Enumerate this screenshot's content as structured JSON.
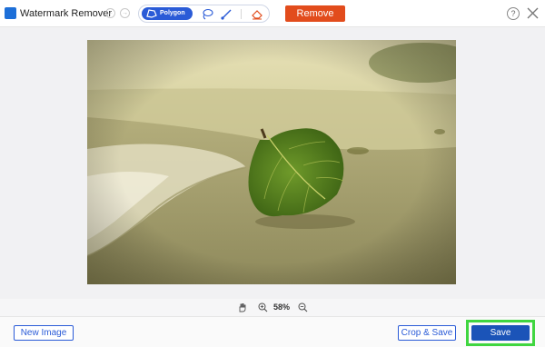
{
  "header": {
    "app_title": "Watermark Remover",
    "tools": {
      "polygon_label": "Polygon"
    },
    "remove_label": "Remove",
    "help_glyph": "?"
  },
  "icons": {
    "app_logo": "watermark-app-icon",
    "undo": "undo-icon",
    "redo": "redo-icon",
    "polygon": "polygon-icon",
    "lasso": "lasso-icon",
    "brush": "brush-icon",
    "eraser": "eraser-icon",
    "help": "help-icon",
    "close": "close-icon",
    "hand": "hand-icon",
    "zoom_in": "zoom-in-icon",
    "zoom_out": "zoom-out-icon"
  },
  "canvas": {
    "image_subject": "green leaf on sandy beach"
  },
  "zoom": {
    "value": "58%"
  },
  "footer": {
    "new_image_label": "New Image",
    "crop_save_label": "Crop & Save",
    "save_label": "Save"
  },
  "colors": {
    "accent_blue": "#2a5bd7",
    "remove_orange": "#e24c1c",
    "save_blue": "#1b54b8",
    "highlight_green": "#40d640"
  }
}
